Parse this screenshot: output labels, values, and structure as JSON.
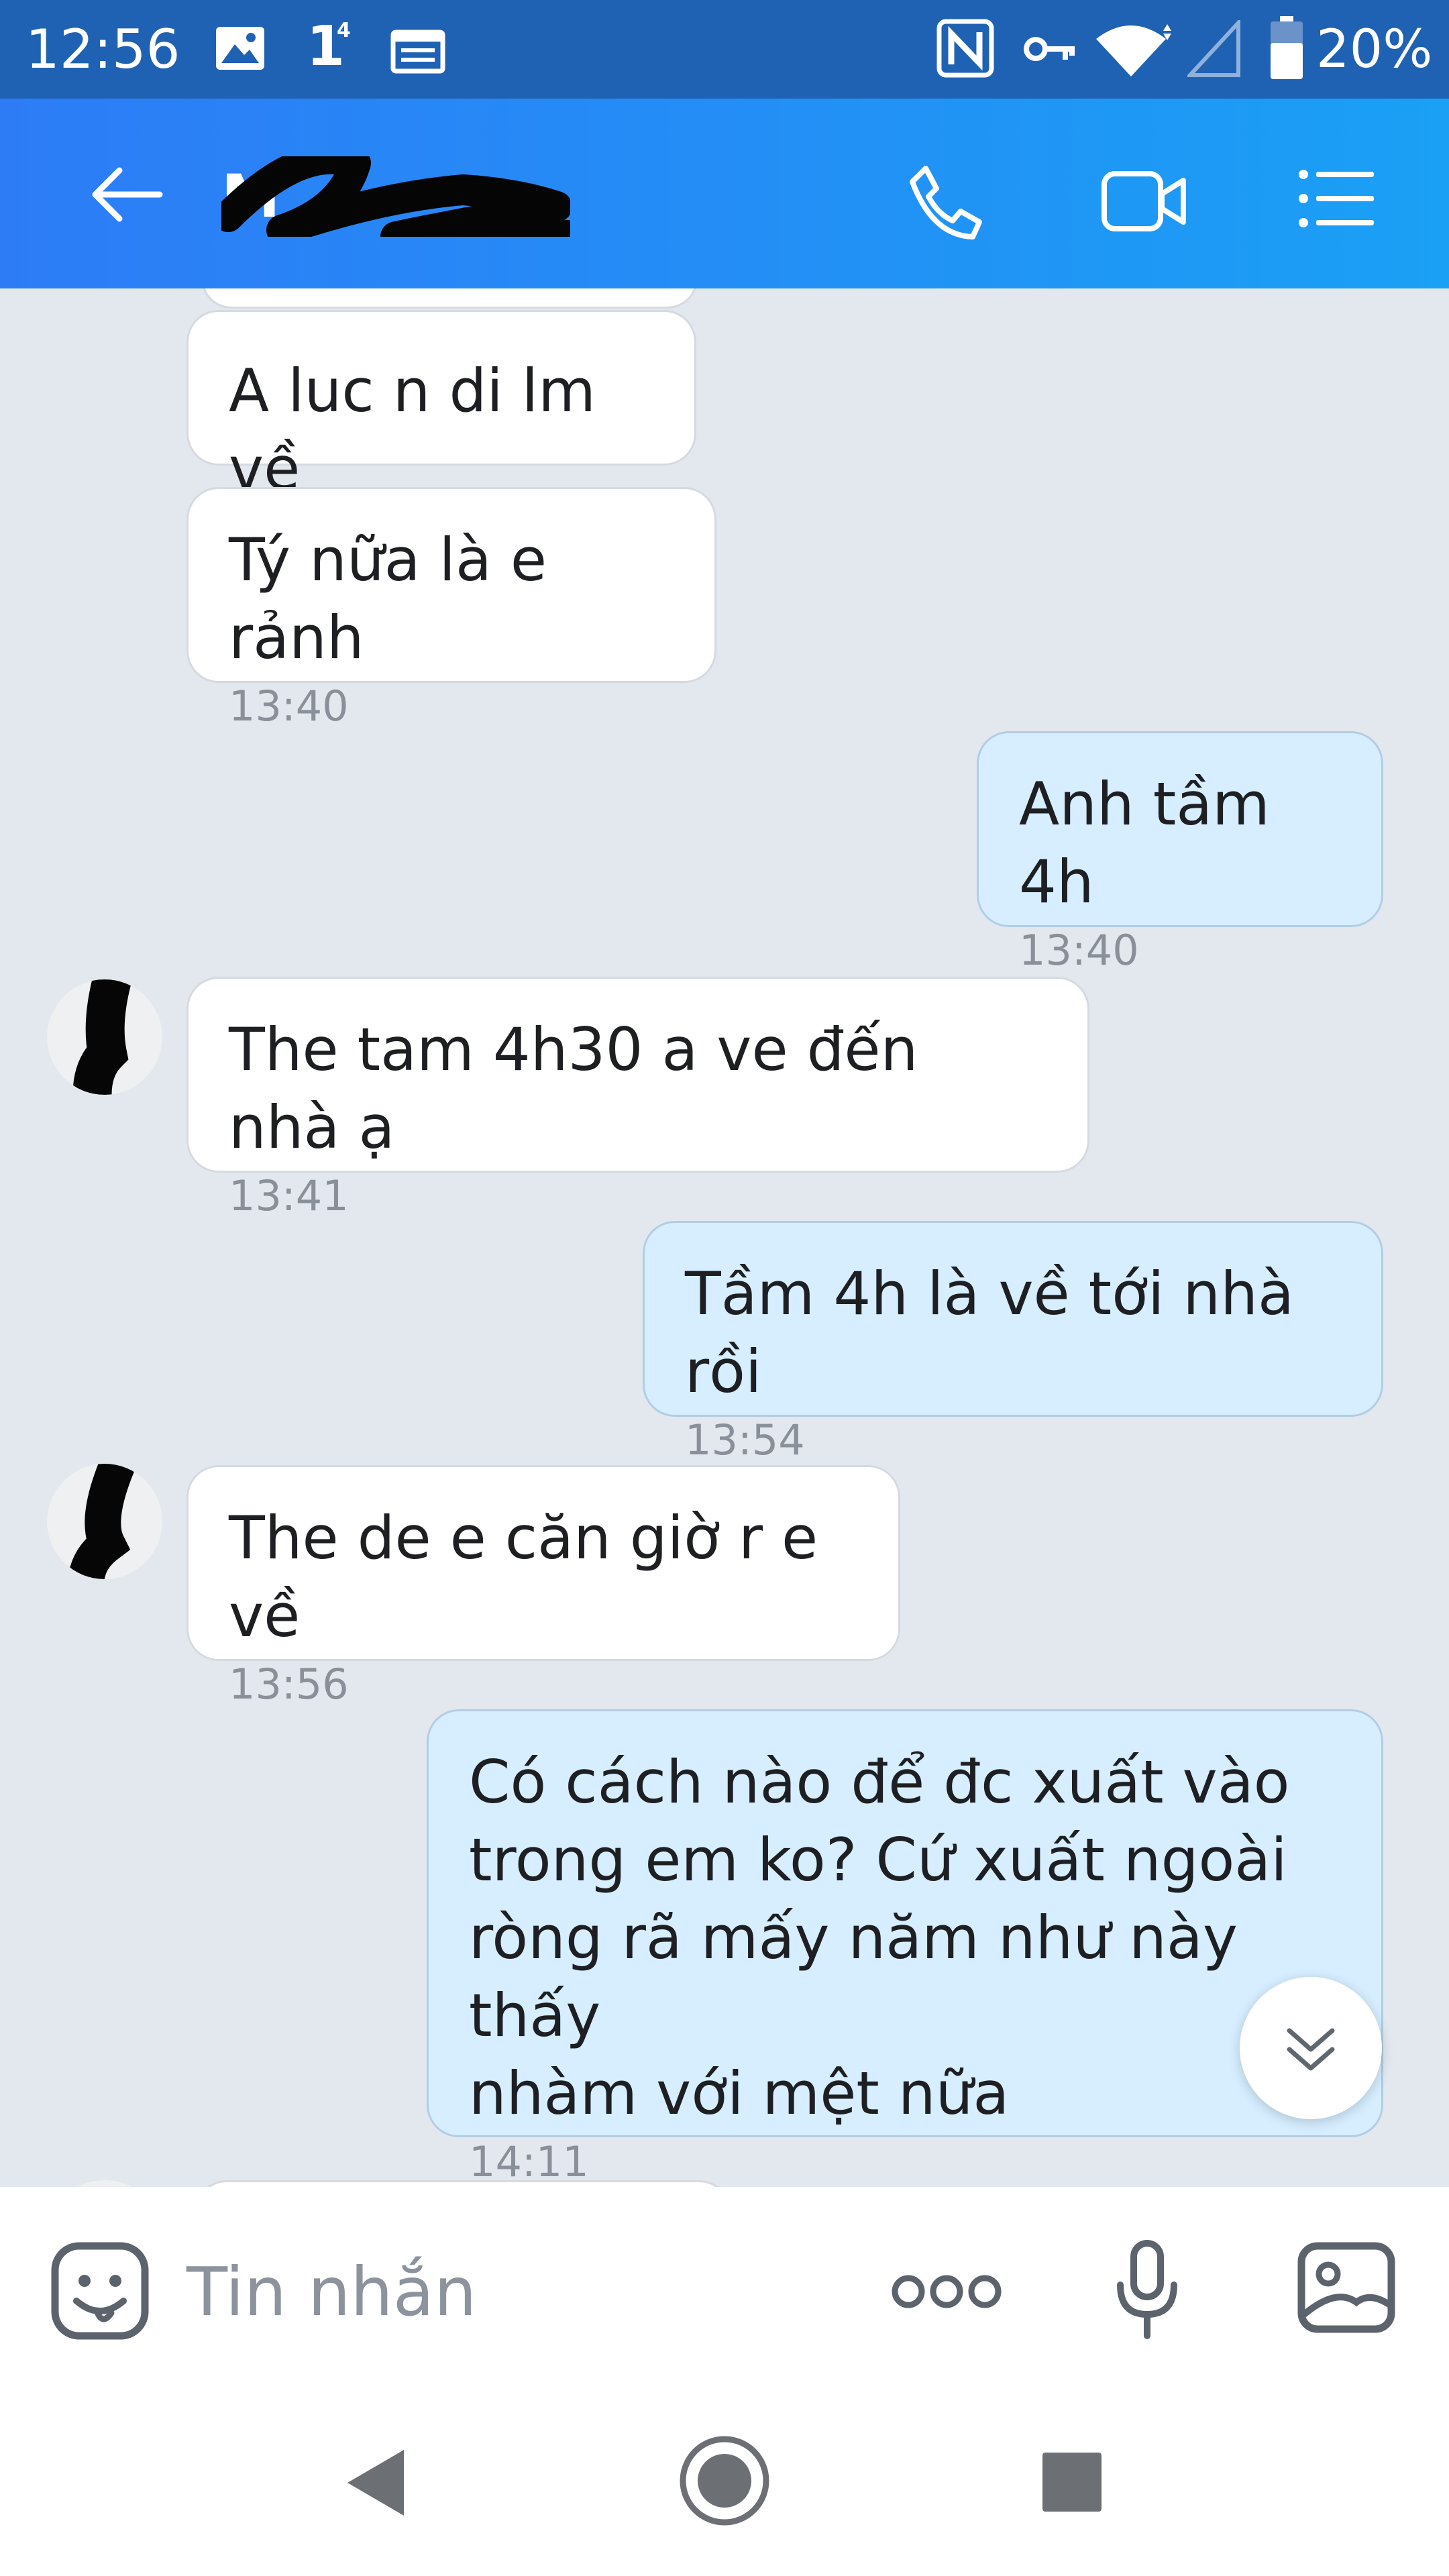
{
  "status_bar": {
    "time": "12:56",
    "sim_indicator": "1",
    "sim_superscript": "4",
    "battery": "20%",
    "icons": [
      "image-icon",
      "calendar-icon",
      "nfc-icon",
      "vpn-key-icon",
      "wifi-icon",
      "signal-icon",
      "battery-icon"
    ]
  },
  "header": {
    "contact_name": "M",
    "icons": [
      "back-arrow-icon",
      "phone-call-icon",
      "video-call-icon",
      "menu-list-icon"
    ]
  },
  "messages": [
    {
      "direction": "in",
      "text": "A luc n di lm về",
      "time": ""
    },
    {
      "direction": "in",
      "text": "Tý nữa là e rảnh",
      "time": "13:40"
    },
    {
      "direction": "out",
      "text": "Anh tầm 4h",
      "time": "13:40"
    },
    {
      "direction": "in",
      "text": "The tam 4h30 a ve đến nhà ạ",
      "time": "13:41"
    },
    {
      "direction": "out",
      "text": "Tầm 4h là về tới nhà rồi",
      "time": "13:54"
    },
    {
      "direction": "in",
      "text": "The de e căn giờ r e về",
      "time": "13:56"
    },
    {
      "direction": "out",
      "text": "Có cách nào để đc xuất vào\ntrong em ko? Cứ xuất ngoài\nròng rã mấy năm như này thấy\nnhàm với mệt nữa",
      "time": "14:11"
    }
  ],
  "composer": {
    "placeholder": "Tin nhắn",
    "icons": [
      "sticker-icon",
      "more-options-icon",
      "microphone-icon",
      "gallery-icon"
    ]
  },
  "colors": {
    "status_bar": "#1f62b3",
    "header_start": "#2d7cf6",
    "header_end": "#1aa0f5",
    "chat_background": "#e3e8ef",
    "incoming_bubble": "#ffffff",
    "outgoing_bubble": "#d6eeff"
  }
}
